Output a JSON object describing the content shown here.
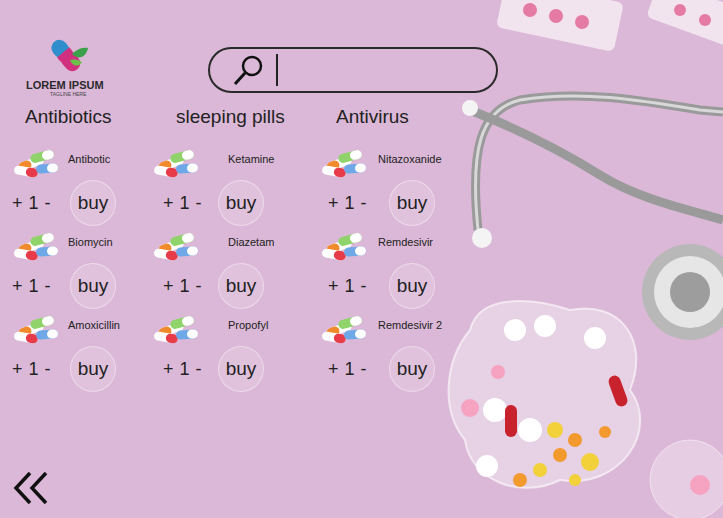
{
  "logo": {
    "title": "LOREM IPSUM",
    "tagline": "TAGLINE HERE"
  },
  "search": {
    "placeholder": ""
  },
  "categories": [
    {
      "title": "Antibiotics",
      "items": [
        {
          "name": "Antibotic",
          "plus": "+",
          "quantity": "1",
          "minus": "-",
          "buy": "buy"
        },
        {
          "name": "Biomycin",
          "plus": "+",
          "quantity": "1",
          "minus": "-",
          "buy": "buy"
        },
        {
          "name": "Amoxicillin",
          "plus": "+",
          "quantity": "1",
          "minus": "-",
          "buy": "buy"
        }
      ]
    },
    {
      "title": "sleeping pills",
      "items": [
        {
          "name": "Ketamine",
          "plus": "+",
          "quantity": "1",
          "minus": "-",
          "buy": "buy"
        },
        {
          "name": "Diazetam",
          "plus": "+",
          "quantity": "1",
          "minus": "-",
          "buy": "buy"
        },
        {
          "name": "Propofyl",
          "plus": "+",
          "quantity": "1",
          "minus": "-",
          "buy": "buy"
        }
      ]
    },
    {
      "title": "Antivirus",
      "items": [
        {
          "name": "Nitazoxanide",
          "plus": "+",
          "quantity": "1",
          "minus": "-",
          "buy": "buy"
        },
        {
          "name": "Remdesivir",
          "plus": "+",
          "quantity": "1",
          "minus": "-",
          "buy": "buy"
        },
        {
          "name": "Remdesivir 2",
          "plus": "+",
          "quantity": "1",
          "minus": "-",
          "buy": "buy"
        }
      ]
    }
  ]
}
